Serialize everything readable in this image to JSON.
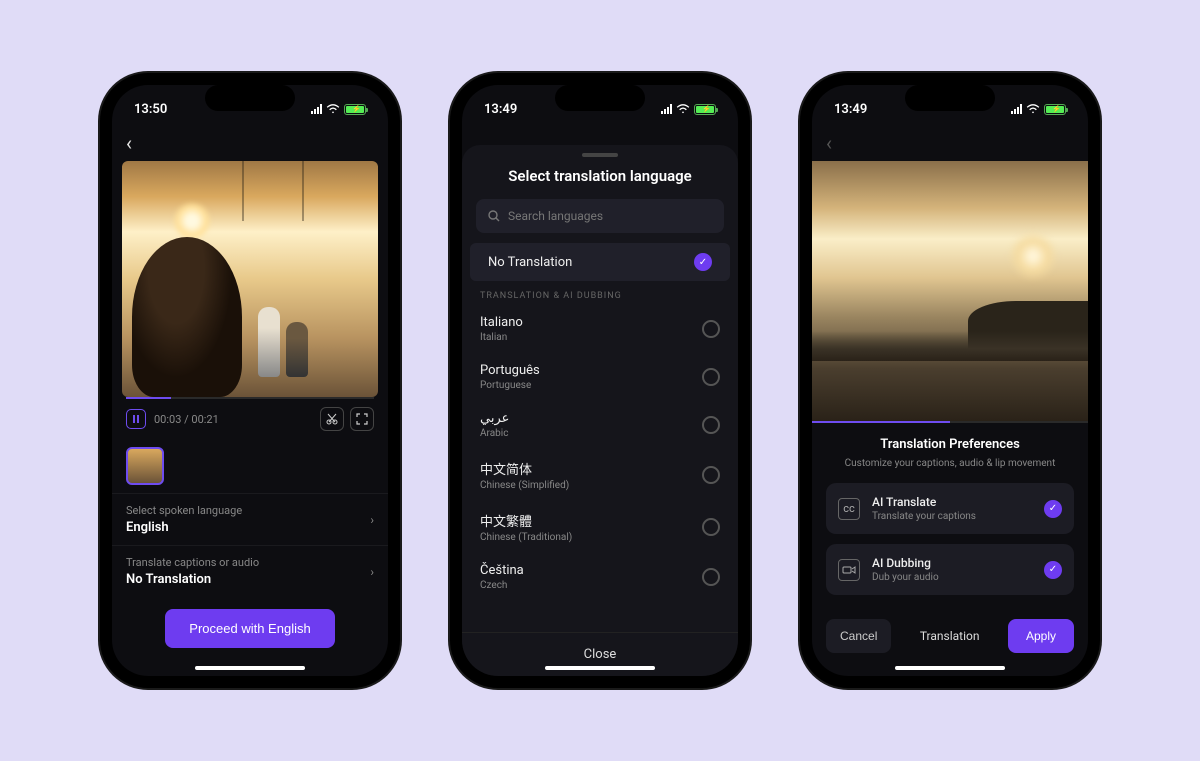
{
  "phone1": {
    "time": "13:50",
    "playback": {
      "current": "00:03",
      "total": "00:21",
      "timecode": "00:03 / 00:21"
    },
    "rows": {
      "spoken": {
        "label": "Select spoken language",
        "value": "English"
      },
      "translate": {
        "label": "Translate captions or audio",
        "value": "No Translation"
      }
    },
    "proceed_button": "Proceed with English"
  },
  "phone2": {
    "time": "13:49",
    "title": "Select translation language",
    "search_placeholder": "Search languages",
    "selected_option": "No Translation",
    "section_header": "TRANSLATION & AI DUBBING",
    "languages": [
      {
        "native": "Italiano",
        "english": "Italian"
      },
      {
        "native": "Português",
        "english": "Portuguese"
      },
      {
        "native": "عربي",
        "english": "Arabic"
      },
      {
        "native": "中文简体",
        "english": "Chinese (Simplified)"
      },
      {
        "native": "中文繁體",
        "english": "Chinese (Traditional)"
      },
      {
        "native": "Čeština",
        "english": "Czech"
      }
    ],
    "close_button": "Close"
  },
  "phone3": {
    "time": "13:49",
    "prefs": {
      "title": "Translation Preferences",
      "subtitle": "Customize your captions, audio & lip movement",
      "ai_translate": {
        "title": "AI Translate",
        "subtitle": "Translate your captions",
        "checked": true
      },
      "ai_dubbing": {
        "title": "AI Dubbing",
        "subtitle": "Dub your audio",
        "checked": true
      }
    },
    "actions": {
      "cancel": "Cancel",
      "tab": "Translation",
      "apply": "Apply"
    }
  }
}
